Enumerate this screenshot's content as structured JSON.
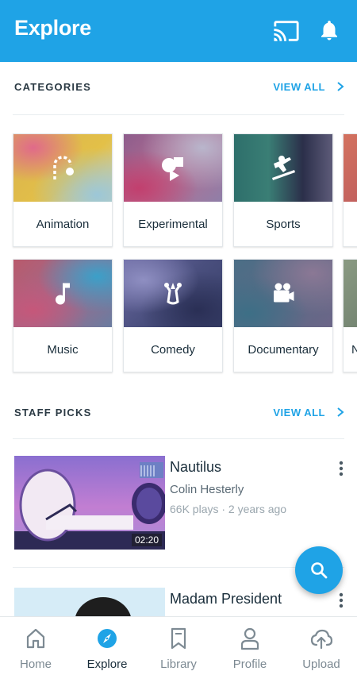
{
  "header": {
    "title": "Explore",
    "icons": [
      "cast-icon",
      "bell-icon"
    ]
  },
  "categories": {
    "label": "CATEGORIES",
    "view_all": "VIEW ALL",
    "items": [
      {
        "label": "Animation",
        "icon": "animation-icon"
      },
      {
        "label": "Experimental",
        "icon": "experimental-icon"
      },
      {
        "label": "Sports",
        "icon": "sports-icon"
      },
      {
        "label": "",
        "icon": ""
      },
      {
        "label": "Music",
        "icon": "music-note-icon"
      },
      {
        "label": "Comedy",
        "icon": "comedy-icon"
      },
      {
        "label": "Documentary",
        "icon": "camera-icon"
      },
      {
        "label": "N",
        "icon": ""
      }
    ]
  },
  "staff_picks": {
    "label": "STAFF PICKS",
    "view_all": "VIEW ALL",
    "videos": [
      {
        "title": "Nautilus",
        "author": "Colin Hesterly",
        "stats": "66K plays · 2 years ago",
        "duration": "02:20"
      },
      {
        "title": "Madam President",
        "author": "",
        "stats": "",
        "duration": ""
      }
    ]
  },
  "fab": {
    "icon": "search-icon"
  },
  "bottom_nav": {
    "active": "Explore",
    "items": [
      {
        "label": "Home",
        "icon": "home-icon"
      },
      {
        "label": "Explore",
        "icon": "compass-icon"
      },
      {
        "label": "Library",
        "icon": "bookmark-icon"
      },
      {
        "label": "Profile",
        "icon": "person-icon"
      },
      {
        "label": "Upload",
        "icon": "cloud-upload-icon"
      }
    ]
  },
  "colors": {
    "accent": "#1fa3e6",
    "text": "#1a2e3b",
    "muted": "#7d8a93"
  }
}
